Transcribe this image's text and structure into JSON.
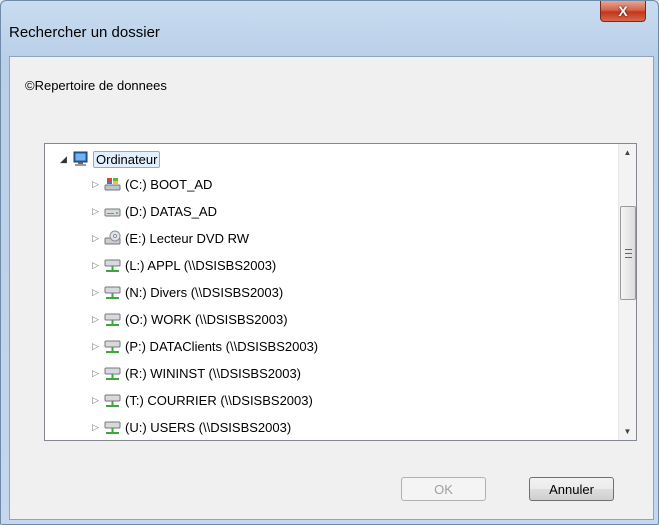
{
  "window": {
    "title": "Rechercher un dossier",
    "close_glyph": "X"
  },
  "description": "©Repertoire de donnees",
  "tree": {
    "root": {
      "label": "Ordinateur",
      "icon": "computer-icon"
    },
    "items": [
      {
        "label": "(C:) BOOT_AD",
        "icon": "system-drive-icon"
      },
      {
        "label": "(D:) DATAS_AD",
        "icon": "hard-drive-icon"
      },
      {
        "label": "(E:) Lecteur DVD RW",
        "icon": "dvd-drive-icon"
      },
      {
        "label": "(L:) APPL (\\\\DSISBS2003)",
        "icon": "network-drive-icon"
      },
      {
        "label": "(N:) Divers (\\\\DSISBS2003)",
        "icon": "network-drive-icon"
      },
      {
        "label": "(O:) WORK (\\\\DSISBS2003)",
        "icon": "network-drive-icon"
      },
      {
        "label": "(P:) DATAClients (\\\\DSISBS2003)",
        "icon": "network-drive-icon"
      },
      {
        "label": "(R:) WININST (\\\\DSISBS2003)",
        "icon": "network-drive-icon"
      },
      {
        "label": "(T:) COURRIER (\\\\DSISBS2003)",
        "icon": "network-drive-icon"
      },
      {
        "label": "(U:) USERS (\\\\DSISBS2003)",
        "icon": "network-drive-icon"
      }
    ]
  },
  "buttons": {
    "ok": "OK",
    "cancel": "Annuler"
  }
}
